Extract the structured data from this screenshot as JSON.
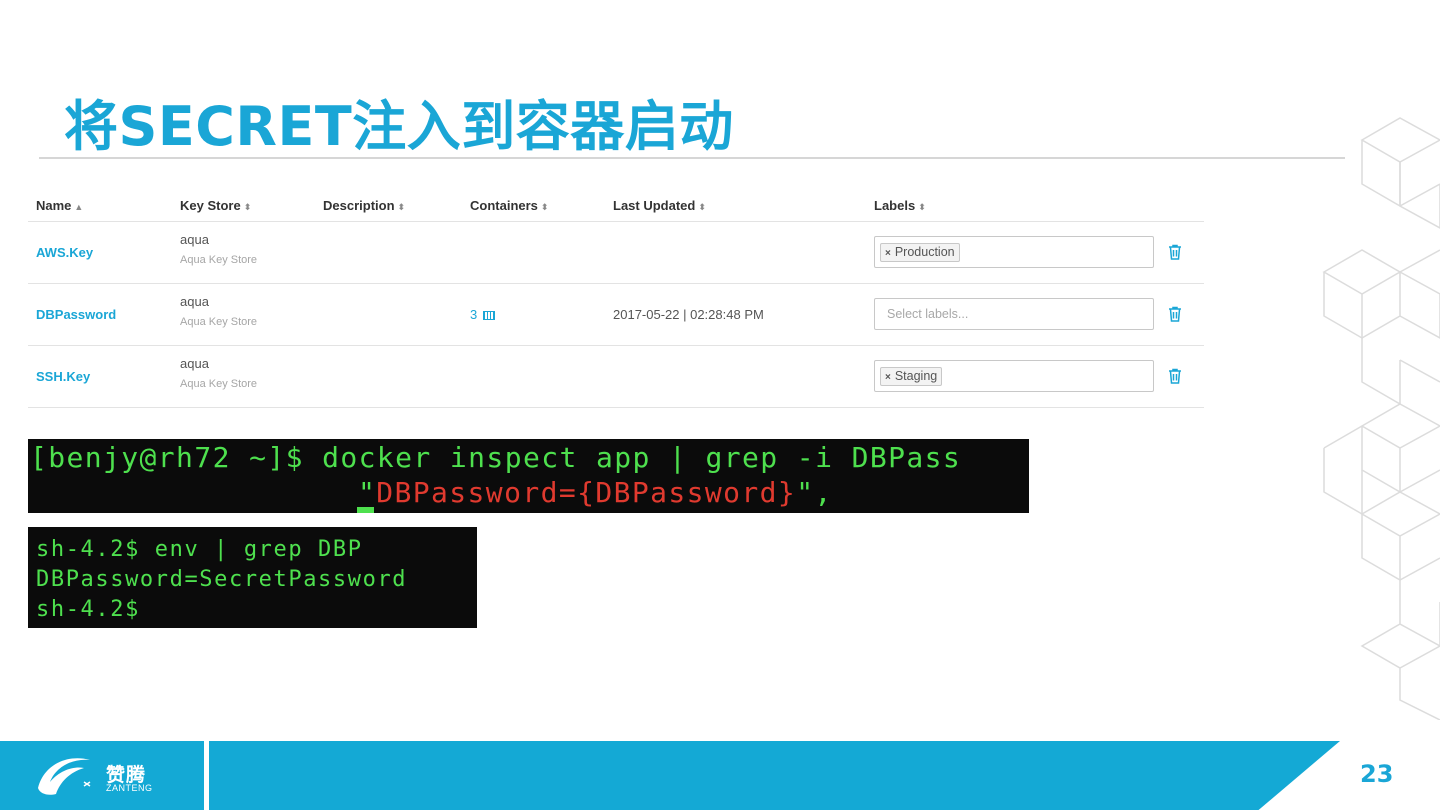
{
  "slide": {
    "title": "将SECRET注入到容器启动",
    "page_number": "23"
  },
  "table": {
    "columns": [
      {
        "label": "Name",
        "sort": "▲"
      },
      {
        "label": "Key Store",
        "sort": "⬍"
      },
      {
        "label": "Description",
        "sort": "⬍"
      },
      {
        "label": "Containers",
        "sort": "⬍"
      },
      {
        "label": "Last Updated",
        "sort": "⬍"
      },
      {
        "label": "Labels",
        "sort": "⬍"
      }
    ],
    "rows": [
      {
        "name": "AWS.Key",
        "key_store": "aqua",
        "key_store_sub": "Aqua Key Store",
        "containers": "",
        "last_updated": "",
        "label": "Production",
        "placeholder": ""
      },
      {
        "name": "DBPassword",
        "key_store": "aqua",
        "key_store_sub": "Aqua Key Store",
        "containers": "3",
        "last_updated": "2017-05-22 | 02:28:48 PM",
        "label": "",
        "placeholder": "Select labels..."
      },
      {
        "name": "SSH.Key",
        "key_store": "aqua",
        "key_store_sub": "Aqua Key Store",
        "containers": "",
        "last_updated": "",
        "label": "Staging",
        "placeholder": ""
      }
    ]
  },
  "terminal1": {
    "line1": "[benjy@rh72 ~]$ docker inspect app | grep -i DBPass",
    "line2_quote_open": "\"",
    "line2_red": "DBPassword={DBPassword}",
    "line2_tail": "\","
  },
  "terminal2": {
    "lines": [
      "sh-4.2$ env | grep DBP",
      "DBPassword=SecretPassword",
      "sh-4.2$"
    ]
  },
  "footer": {
    "logo_cn": "赞腾",
    "logo_en": "ZANTENG"
  },
  "colors": {
    "accent": "#1aa6d6",
    "terminal_green": "#4ee04e",
    "terminal_red": "#e03a2f"
  }
}
